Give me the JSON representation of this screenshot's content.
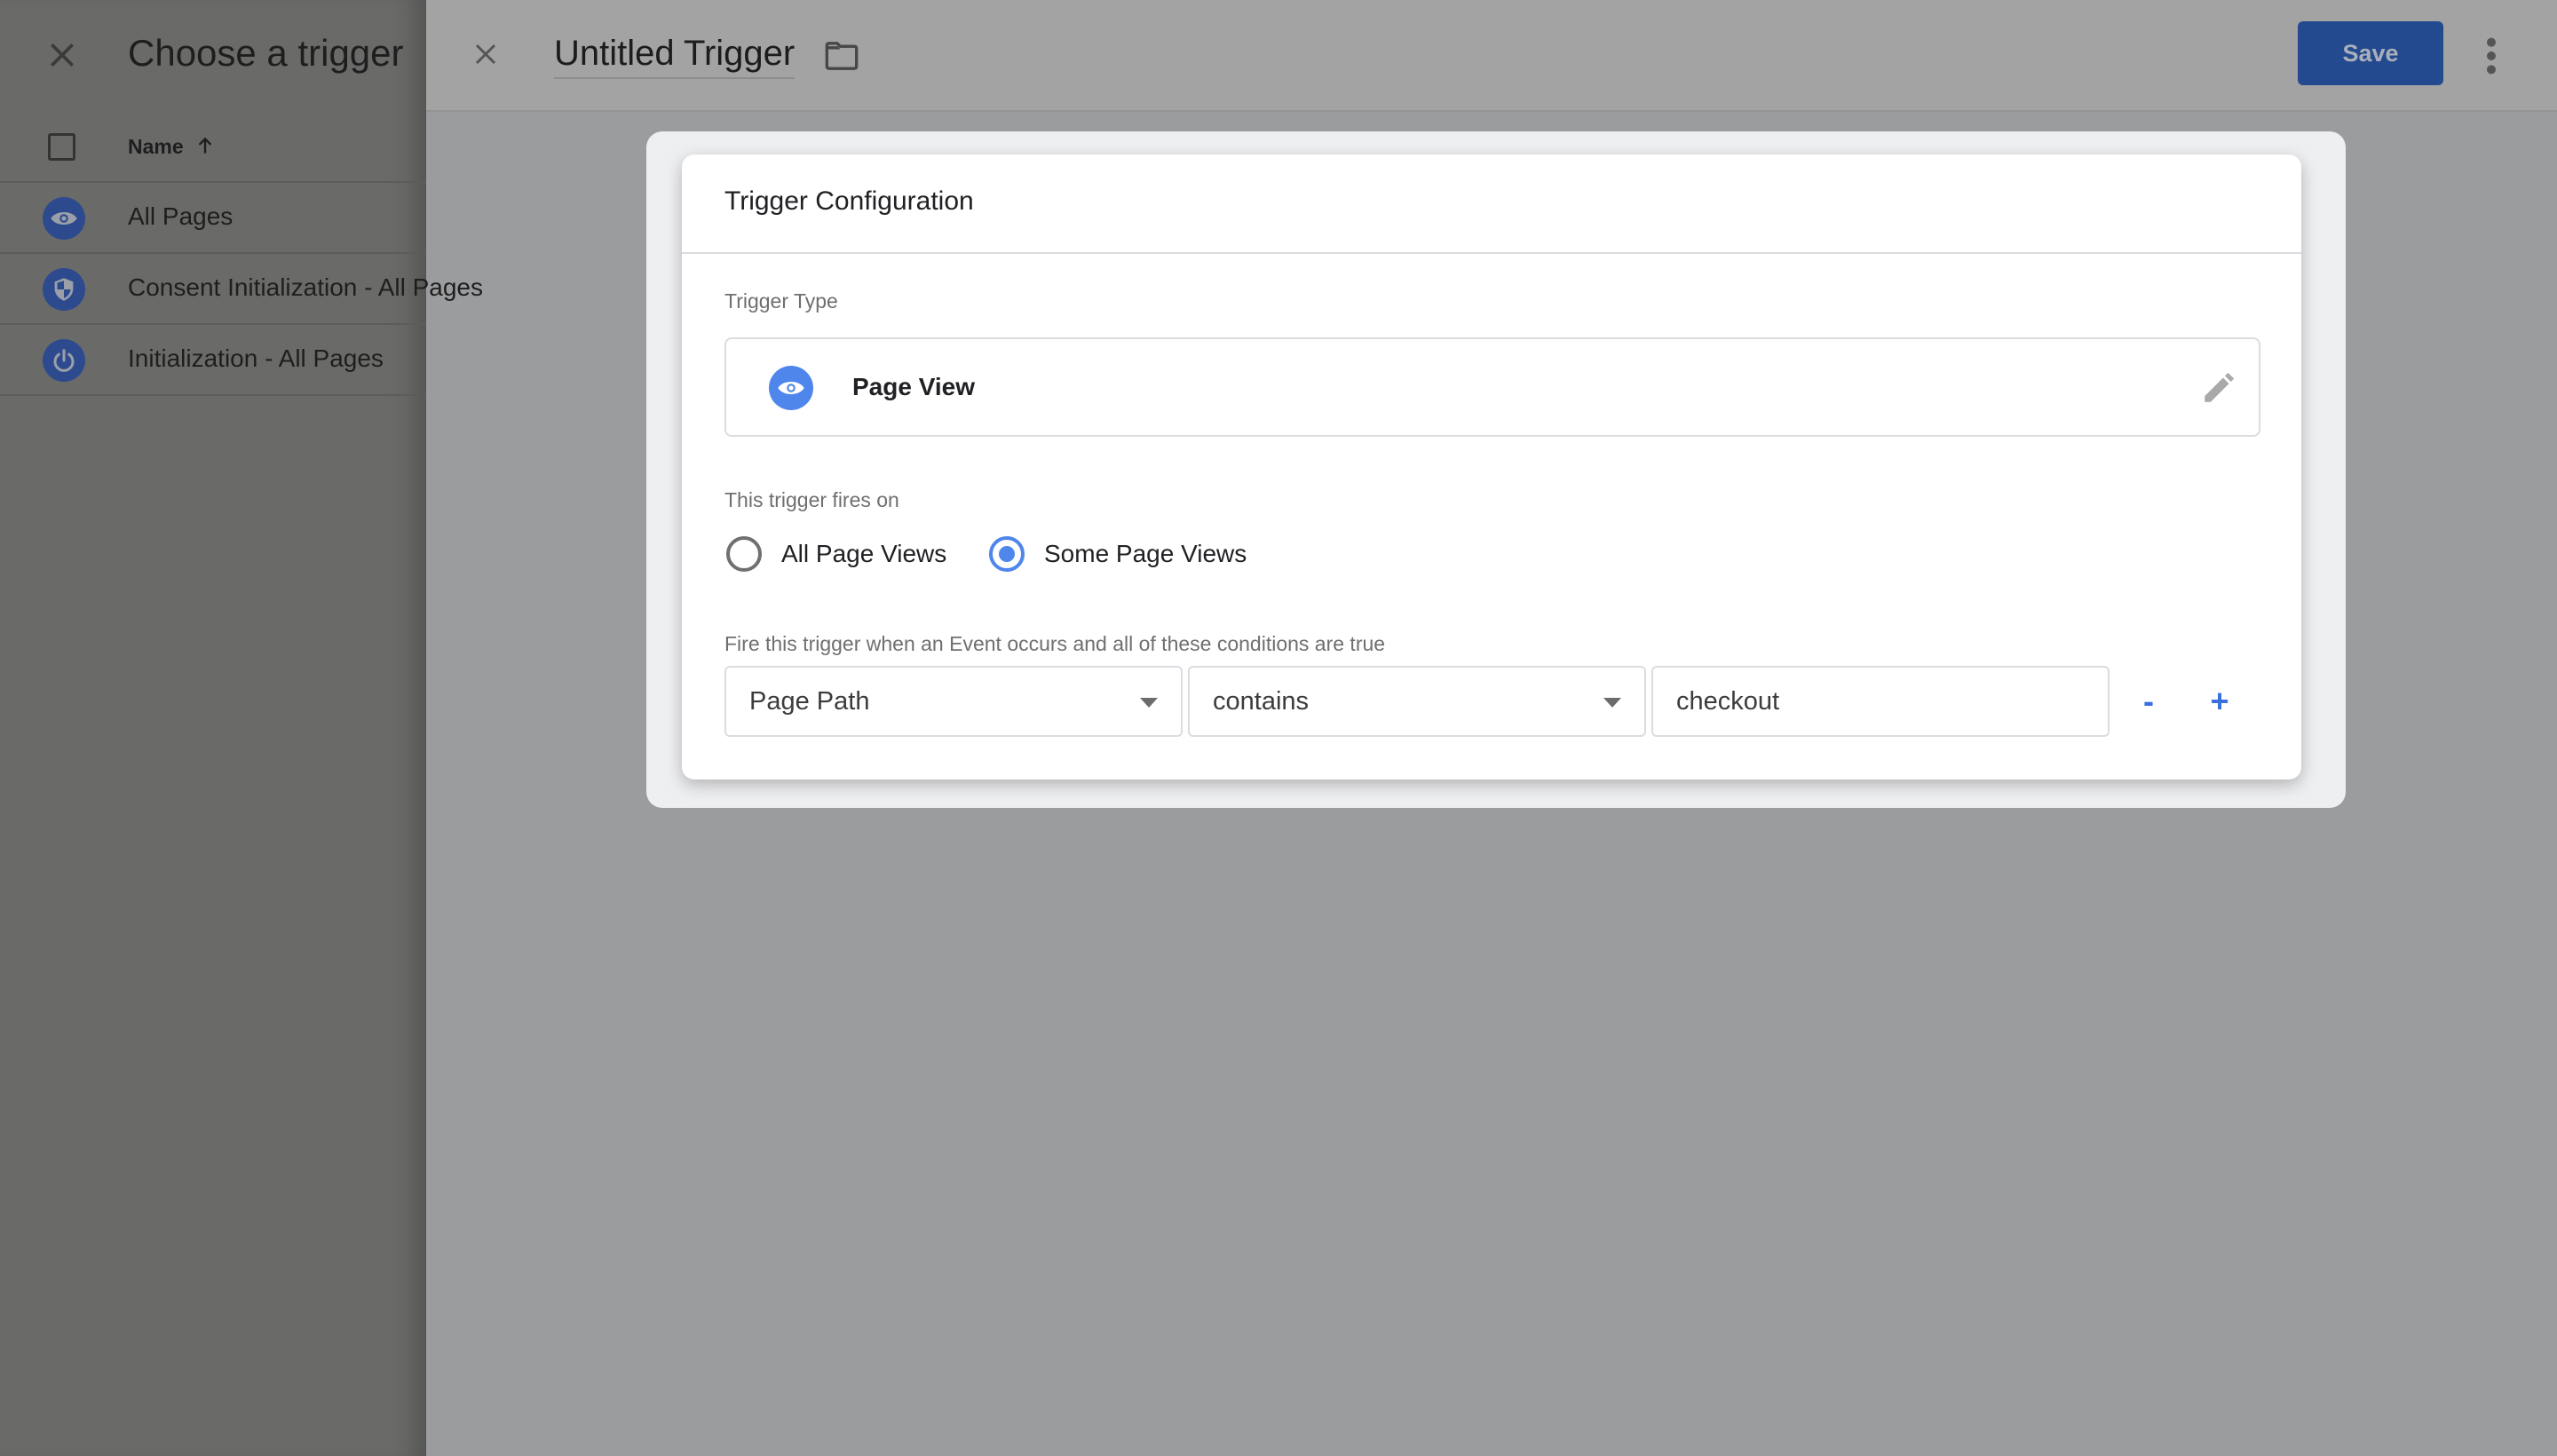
{
  "left_panel": {
    "title": "Choose a trigger",
    "close_icon": "close-icon",
    "table": {
      "column_header": "Name",
      "sort_direction": "ascending",
      "rows": [
        {
          "label": "All Pages",
          "icon": "eye-icon"
        },
        {
          "label": "Consent Initialization - All Pages",
          "icon": "shield-icon"
        },
        {
          "label": "Initialization - All Pages",
          "icon": "power-icon"
        }
      ]
    }
  },
  "top_bar": {
    "trigger_name": "Untitled Trigger",
    "save_label": "Save",
    "folder_icon": "folder-icon",
    "more_icon": "more-vert-icon"
  },
  "config": {
    "title": "Trigger Configuration",
    "trigger_type_label": "Trigger Type",
    "trigger_type": "Page View",
    "fires_on_label": "This trigger fires on",
    "fires_on_options": [
      {
        "label": "All Page Views",
        "checked": false
      },
      {
        "label": "Some Page Views",
        "checked": true
      }
    ],
    "condition_label": "Fire this trigger when an Event occurs and all of these conditions are true",
    "condition": {
      "variable": "Page Path",
      "operator": "contains",
      "value": "checkout",
      "remove_label": "-",
      "add_label": "+"
    }
  },
  "colors": {
    "accent": "#4f86ec",
    "save_button": "#23498f",
    "icon_badge_dimmed": "#2d4a8f"
  }
}
